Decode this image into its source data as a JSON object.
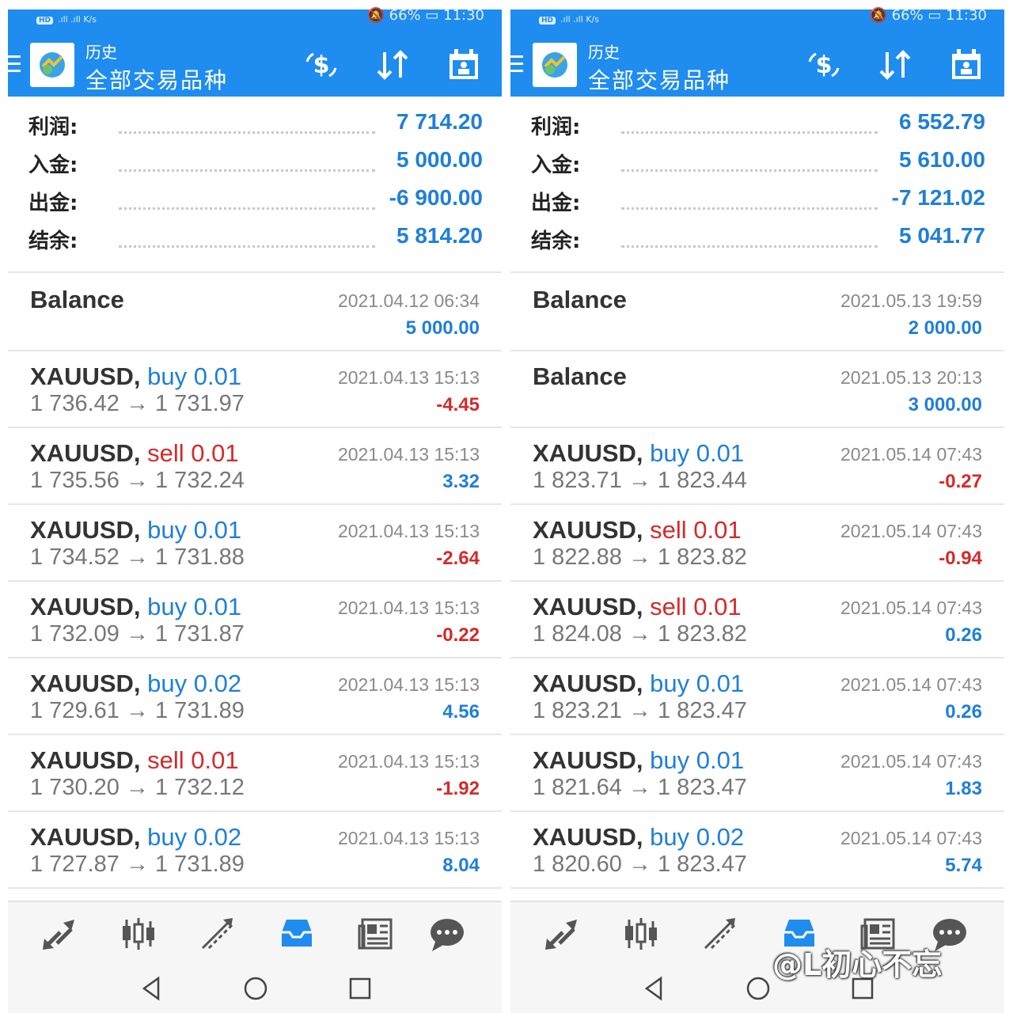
{
  "panels": [
    {
      "status_left": "K/s",
      "status_battery": "66%",
      "status_time": "11:30",
      "appbar": {
        "subtitle": "历史",
        "title": "全部交易品种"
      },
      "summary": [
        {
          "label": "利润:",
          "value": "7 714.20"
        },
        {
          "label": "入金:",
          "value": "5 000.00"
        },
        {
          "label": "出金:",
          "value": "-6 900.00"
        },
        {
          "label": "结余:",
          "value": "5 814.20"
        }
      ],
      "deals": [
        {
          "kind": "balance",
          "title": "Balance",
          "time": "2021.04.12 06:34",
          "profit": "5 000.00",
          "profit_sign": "pos"
        },
        {
          "kind": "trade",
          "symbol": "XAUUSD,",
          "side": "buy 0.01",
          "side_type": "buy",
          "prices": "1 736.42 → 1 731.97",
          "time": "2021.04.13 15:13",
          "profit": "-4.45",
          "profit_sign": "neg"
        },
        {
          "kind": "trade",
          "symbol": "XAUUSD,",
          "side": "sell 0.01",
          "side_type": "sell",
          "prices": "1 735.56 → 1 732.24",
          "time": "2021.04.13 15:13",
          "profit": "3.32",
          "profit_sign": "pos"
        },
        {
          "kind": "trade",
          "symbol": "XAUUSD,",
          "side": "buy 0.01",
          "side_type": "buy",
          "prices": "1 734.52 → 1 731.88",
          "time": "2021.04.13 15:13",
          "profit": "-2.64",
          "profit_sign": "neg"
        },
        {
          "kind": "trade",
          "symbol": "XAUUSD,",
          "side": "buy 0.01",
          "side_type": "buy",
          "prices": "1 732.09 → 1 731.87",
          "time": "2021.04.13 15:13",
          "profit": "-0.22",
          "profit_sign": "neg"
        },
        {
          "kind": "trade",
          "symbol": "XAUUSD,",
          "side": "buy 0.02",
          "side_type": "buy",
          "prices": "1 729.61 → 1 731.89",
          "time": "2021.04.13 15:13",
          "profit": "4.56",
          "profit_sign": "pos"
        },
        {
          "kind": "trade",
          "symbol": "XAUUSD,",
          "side": "sell 0.01",
          "side_type": "sell",
          "prices": "1 730.20 → 1 732.12",
          "time": "2021.04.13 15:13",
          "profit": "-1.92",
          "profit_sign": "neg"
        },
        {
          "kind": "trade",
          "symbol": "XAUUSD,",
          "side": "buy 0.02",
          "side_type": "buy",
          "prices": "1 727.87 → 1 731.89",
          "time": "2021.04.13 15:13",
          "profit": "8.04",
          "profit_sign": "pos"
        }
      ]
    },
    {
      "status_left": "K/s",
      "status_battery": "66%",
      "status_time": "11:30",
      "appbar": {
        "subtitle": "历史",
        "title": "全部交易品种"
      },
      "summary": [
        {
          "label": "利润:",
          "value": "6 552.79"
        },
        {
          "label": "入金:",
          "value": "5 610.00"
        },
        {
          "label": "出金:",
          "value": "-7 121.02"
        },
        {
          "label": "结余:",
          "value": "5 041.77"
        }
      ],
      "deals": [
        {
          "kind": "balance",
          "title": "Balance",
          "time": "2021.05.13 19:59",
          "profit": "2 000.00",
          "profit_sign": "pos"
        },
        {
          "kind": "balance",
          "title": "Balance",
          "time": "2021.05.13 20:13",
          "profit": "3 000.00",
          "profit_sign": "pos"
        },
        {
          "kind": "trade",
          "symbol": "XAUUSD,",
          "side": "buy 0.01",
          "side_type": "buy",
          "prices": "1 823.71 → 1 823.44",
          "time": "2021.05.14 07:43",
          "profit": "-0.27",
          "profit_sign": "neg"
        },
        {
          "kind": "trade",
          "symbol": "XAUUSD,",
          "side": "sell 0.01",
          "side_type": "sell",
          "prices": "1 822.88 → 1 823.82",
          "time": "2021.05.14 07:43",
          "profit": "-0.94",
          "profit_sign": "neg"
        },
        {
          "kind": "trade",
          "symbol": "XAUUSD,",
          "side": "sell 0.01",
          "side_type": "sell",
          "prices": "1 824.08 → 1 823.82",
          "time": "2021.05.14 07:43",
          "profit": "0.26",
          "profit_sign": "pos"
        },
        {
          "kind": "trade",
          "symbol": "XAUUSD,",
          "side": "buy 0.01",
          "side_type": "buy",
          "prices": "1 823.21 → 1 823.47",
          "time": "2021.05.14 07:43",
          "profit": "0.26",
          "profit_sign": "pos"
        },
        {
          "kind": "trade",
          "symbol": "XAUUSD,",
          "side": "buy 0.01",
          "side_type": "buy",
          "prices": "1 821.64 → 1 823.47",
          "time": "2021.05.14 07:43",
          "profit": "1.83",
          "profit_sign": "pos"
        },
        {
          "kind": "trade",
          "symbol": "XAUUSD,",
          "side": "buy 0.02",
          "side_type": "buy",
          "prices": "1 820.60 → 1 823.47",
          "time": "2021.05.14 07:43",
          "profit": "5.74",
          "profit_sign": "pos"
        }
      ]
    }
  ],
  "icons": {
    "appbar": [
      "menu-icon",
      "app-logo-icon",
      "currency-exchange-icon",
      "sort-icon",
      "calendar-icon"
    ],
    "bottom_nav": [
      "quotes-icon",
      "chart-icon",
      "trade-icon",
      "history-icon",
      "news-icon",
      "chat-icon"
    ],
    "system_nav": [
      "back-icon",
      "home-icon",
      "recents-icon"
    ]
  },
  "colors": {
    "appbar": "#1f8cf0",
    "positive": "#1f7fd8",
    "negative": "#d42a2a",
    "active_nav": "#1f8cf0"
  },
  "watermark": "@L初心不忘"
}
